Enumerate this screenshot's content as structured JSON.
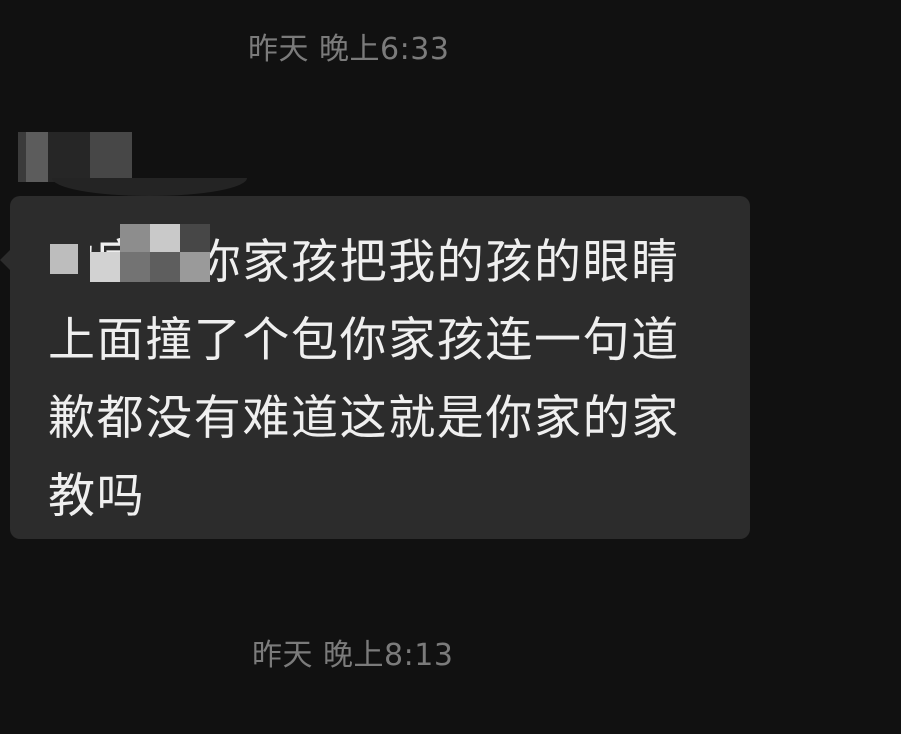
{
  "chat": {
    "timestamp_top": "昨天 晚上6:33",
    "timestamp_bottom": "昨天 晚上8:13",
    "message": {
      "text": "                的家长你家孩把我的孩的眼睛上面撞了个包你家孩连一句道歉都没有难道这就是你家的家教吗"
    }
  },
  "colors": {
    "background": "#111111",
    "bubble": "#2c2c2c",
    "message_text": "#efefef",
    "timestamp": "#7b7b7b"
  },
  "icons": {
    "sender_avatar": "blurred-avatar-icon"
  }
}
